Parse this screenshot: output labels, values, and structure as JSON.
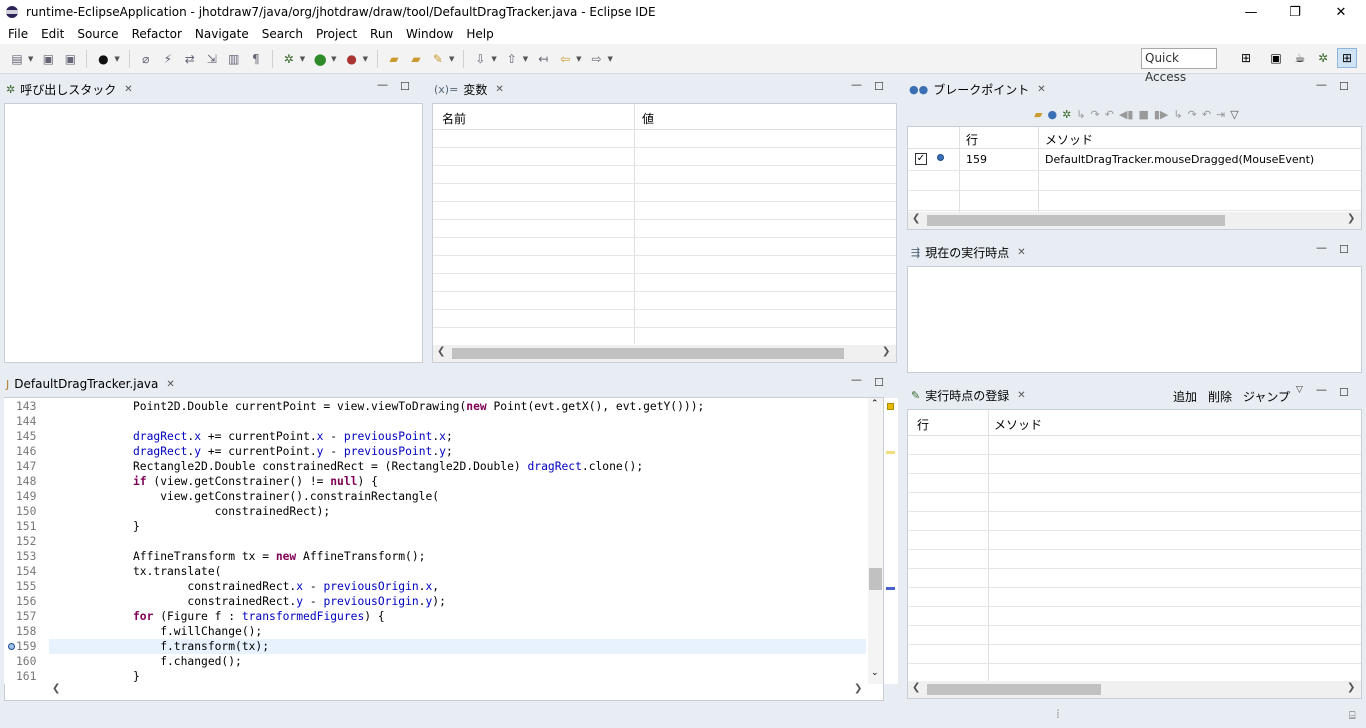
{
  "window": {
    "title": "runtime-EclipseApplication - jhotdraw7/java/org/jhotdraw/draw/tool/DefaultDragTracker.java - Eclipse IDE",
    "minimize_glyph": "—",
    "restore_glyph": "❐",
    "close_glyph": "✕"
  },
  "menu": [
    "File",
    "Edit",
    "Source",
    "Refactor",
    "Navigate",
    "Search",
    "Project",
    "Run",
    "Window",
    "Help"
  ],
  "toolbar": {
    "quick_access": "Quick Access"
  },
  "callstack": {
    "title": "呼び出しスタック"
  },
  "variables": {
    "title": "変数",
    "icon_text": "(x)=",
    "col_name": "名前",
    "col_value": "値"
  },
  "breakpoints": {
    "title": "ブレークポイント",
    "col_line": "行",
    "col_method": "メソッド",
    "rows": [
      {
        "line": "159",
        "method": "DefaultDragTracker.mouseDragged(MouseEvent)",
        "checked": true
      }
    ]
  },
  "current_exec": {
    "title": "現在の実行時点"
  },
  "exec_register": {
    "title": "実行時点の登録",
    "add": "追加",
    "delete": "削除",
    "jump": "ジャンプ",
    "col_line": "行",
    "col_method": "メソッド"
  },
  "editor": {
    "tab_title": "DefaultDragTracker.java",
    "highlight_line": "159",
    "breakpoint_line": "159",
    "lines": [
      {
        "no": "143",
        "text": "            Point2D.Double currentPoint = view.viewToDrawing(new Point(evt.getX(), evt.getY()));"
      },
      {
        "no": "144",
        "text": ""
      },
      {
        "no": "145",
        "text": "            dragRect.x += currentPoint.x - previousPoint.x;"
      },
      {
        "no": "146",
        "text": "            dragRect.y += currentPoint.y - previousPoint.y;"
      },
      {
        "no": "147",
        "text": "            Rectangle2D.Double constrainedRect = (Rectangle2D.Double) dragRect.clone();"
      },
      {
        "no": "148",
        "text": "            if (view.getConstrainer() != null) {"
      },
      {
        "no": "149",
        "text": "                view.getConstrainer().constrainRectangle("
      },
      {
        "no": "150",
        "text": "                        constrainedRect);"
      },
      {
        "no": "151",
        "text": "            }"
      },
      {
        "no": "152",
        "text": ""
      },
      {
        "no": "153",
        "text": "            AffineTransform tx = new AffineTransform();"
      },
      {
        "no": "154",
        "text": "            tx.translate("
      },
      {
        "no": "155",
        "text": "                    constrainedRect.x - previousOrigin.x,"
      },
      {
        "no": "156",
        "text": "                    constrainedRect.y - previousOrigin.y);"
      },
      {
        "no": "157",
        "text": "            for (Figure f : transformedFigures) {"
      },
      {
        "no": "158",
        "text": "                f.willChange();"
      },
      {
        "no": "159",
        "text": "                f.transform(tx);"
      },
      {
        "no": "160",
        "text": "                f.changed();"
      },
      {
        "no": "161",
        "text": "            }"
      }
    ]
  },
  "colors": {
    "keyword": "#7f0055",
    "field": "#0000c0",
    "highlight": "#e8f2fe",
    "background": "#e8edf3"
  }
}
